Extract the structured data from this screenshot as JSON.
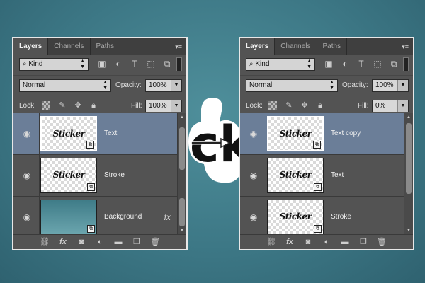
{
  "colors": {
    "selected_row": "#6b7e98",
    "panel_bg": "#535353",
    "background": "#3d7886"
  },
  "sticker_text": "ck",
  "panels": [
    {
      "tabs": [
        "Layers",
        "Channels",
        "Paths"
      ],
      "filter_kind": "Kind",
      "blend_mode": "Normal",
      "opacity_label": "Opacity:",
      "opacity_value": "100%",
      "lock_label": "Lock:",
      "fill_label": "Fill:",
      "fill_value": "100%",
      "layers": [
        {
          "name": "Text",
          "thumb_text": "Sticker",
          "selected": true
        },
        {
          "name": "Stroke",
          "thumb_text": "Sticker",
          "selected": false
        },
        {
          "name": "Background",
          "thumb_text": "",
          "selected": false,
          "fx": "fx"
        }
      ]
    },
    {
      "tabs": [
        "Layers",
        "Channels",
        "Paths"
      ],
      "filter_kind": "Kind",
      "blend_mode": "Normal",
      "opacity_label": "Opacity:",
      "opacity_value": "100%",
      "lock_label": "Lock:",
      "fill_label": "Fill:",
      "fill_value": "0%",
      "layers": [
        {
          "name": "Text copy",
          "thumb_text": "Sticker",
          "selected": true
        },
        {
          "name": "Text",
          "thumb_text": "Sticker",
          "selected": false
        },
        {
          "name": "Stroke",
          "thumb_text": "Sticker",
          "selected": false
        }
      ]
    }
  ]
}
